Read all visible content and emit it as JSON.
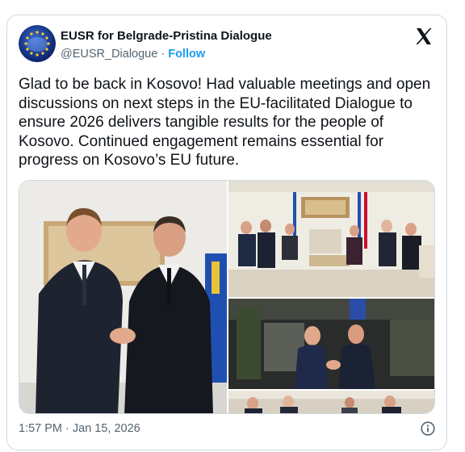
{
  "account": {
    "name": "EUSR for Belgrade-Pristina Dialogue",
    "handle": "@EUSR_Dialogue",
    "separator": "·",
    "follow_label": "Follow",
    "avatar_icon": "eu-stars-globe-avatar"
  },
  "post": {
    "text": "Glad to be back in Kosovo! Had valuable meetings and open discussions on next steps in the EU-facilitated Dialogue to ensure 2026 delivers tangible results for the people of Kosovo. Continued engagement remains essential for progress on Kosovo’s EU future.",
    "timestamp": "1:57 PM · Jan 15, 2026"
  },
  "media": {
    "photos": [
      {
        "name": "photo-handshake-portrait"
      },
      {
        "name": "photo-meeting-room"
      },
      {
        "name": "photo-handshake-greeting"
      },
      {
        "name": "photo-table-discussion"
      }
    ]
  },
  "icons": {
    "logo": "x-logo-icon",
    "info": "info-icon"
  },
  "colors": {
    "link": "#1d9bf0",
    "secondary_text": "#536471",
    "border": "#cfd9de"
  }
}
